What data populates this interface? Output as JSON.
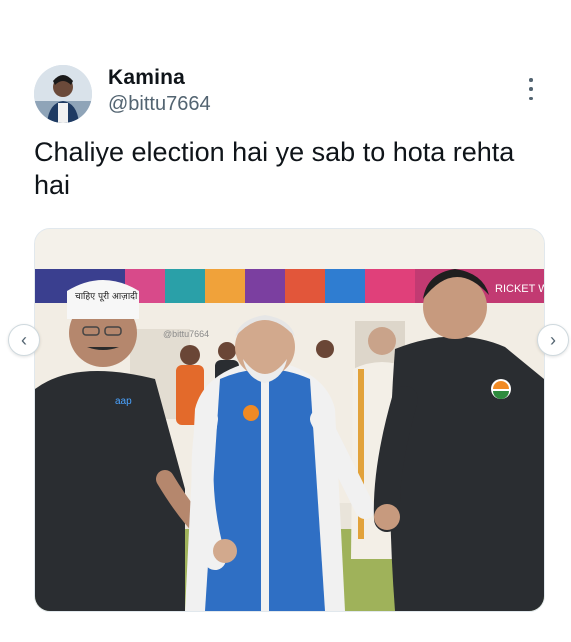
{
  "author": {
    "display_name": "Kamina",
    "handle": "@bittu7664",
    "avatar_icon": "avatar-photo"
  },
  "tweet": {
    "text": "Chaliye election hai ye sab to hota rehta hai"
  },
  "media": {
    "watermark": "@bittu7664",
    "cap_text": "चाहिए पूरी आज़ादी",
    "shirt_logo": "aap",
    "banner_text": "RICKET W"
  },
  "controls": {
    "prev_label": "‹",
    "next_label": "›",
    "more_icon": "more-vertical-icon"
  },
  "colors": {
    "name": "#0f1419",
    "handle": "#536471",
    "jacket_blue": "#2f6fc4",
    "shirt_dark": "#2a2d31",
    "floor": "#9fb25a"
  }
}
